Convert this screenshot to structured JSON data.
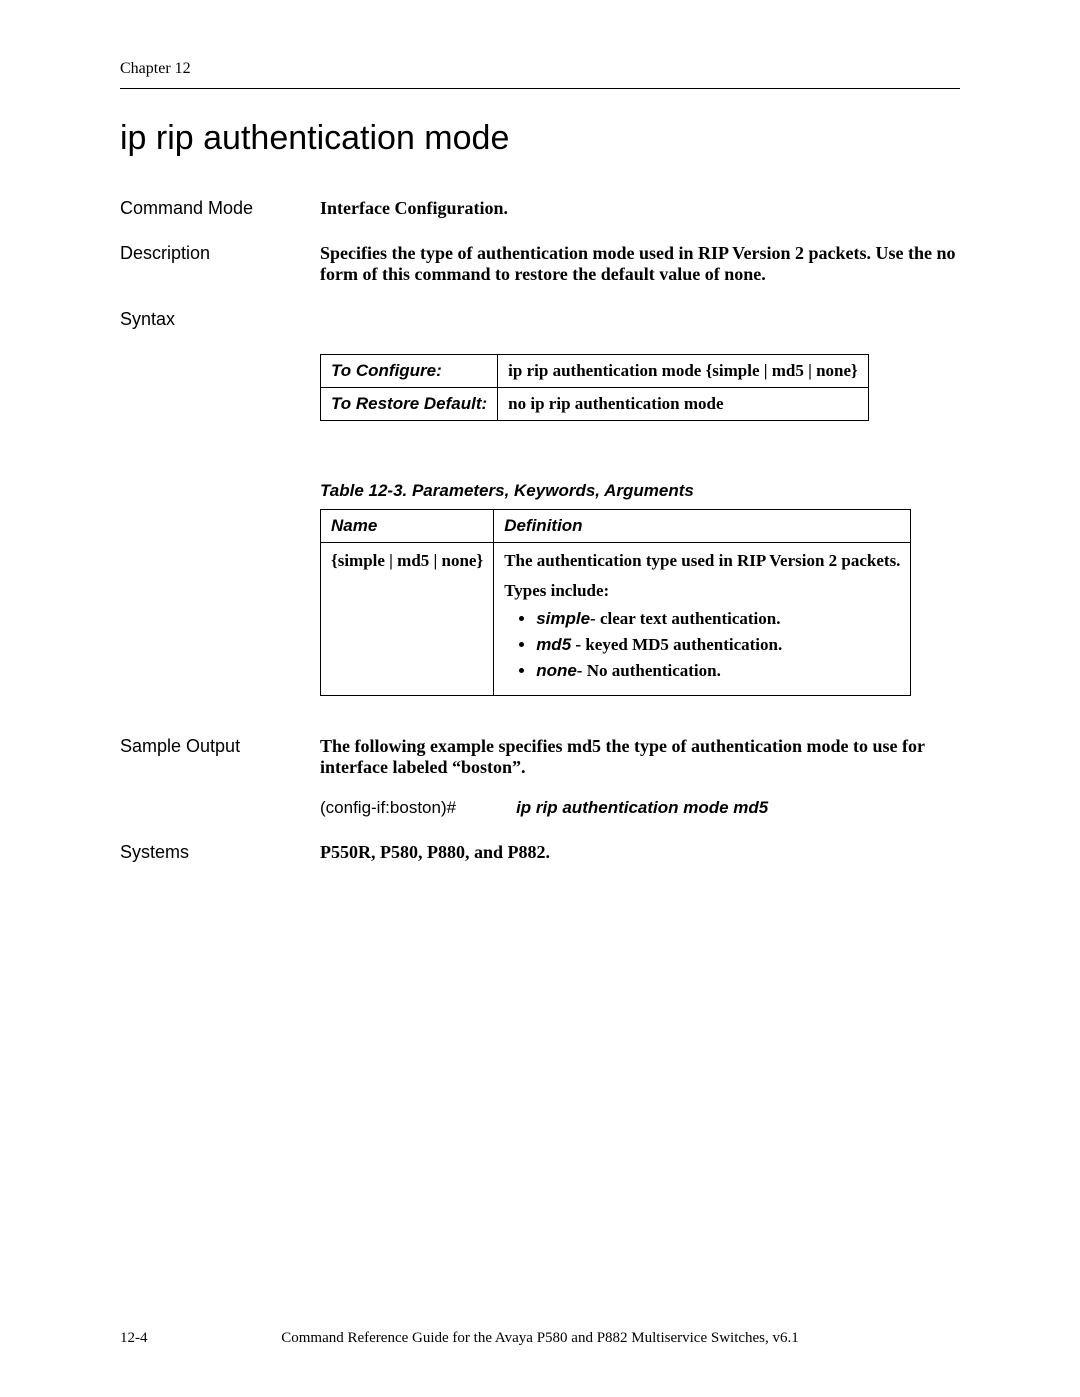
{
  "header": {
    "chapter": "Chapter 12"
  },
  "title": "ip rip authentication mode",
  "sections": {
    "commandMode": {
      "label": "Command Mode",
      "value": "Interface Configuration."
    },
    "description": {
      "label": "Description",
      "value": "Specifies the type of authentication mode used in RIP Version 2 packets. Use the no form of this command to restore the default value of none."
    },
    "syntax": {
      "label": "Syntax"
    },
    "sampleOutput": {
      "label": "Sample Output",
      "lead": "The following example specifies md5 the type of authentication mode to use for interface labeled “boston”.",
      "prompt": "(config-if:boston)#",
      "command": "ip rip authentication mode md5"
    },
    "systems": {
      "label": "Systems",
      "value": "P550R, P580, P880, and P882."
    }
  },
  "syntaxTable": {
    "rows": [
      {
        "label": "To Configure:",
        "value": "ip rip authentication mode {simple | md5 | none}"
      },
      {
        "label": "To Restore Default:",
        "value": "no ip rip authentication mode"
      }
    ]
  },
  "paramTable": {
    "caption": "Table 12-3.  Parameters, Keywords, Arguments",
    "headers": {
      "name": "Name",
      "definition": "Definition"
    },
    "row": {
      "name": "{simple | md5 | none}",
      "defLead": "The authentication type used in RIP Version 2 packets.",
      "defSub": "Types include:",
      "types": [
        {
          "kw": "simple",
          "sep": "- ",
          "text": "clear text authentication."
        },
        {
          "kw": "md5",
          "sep": " - ",
          "text": "keyed MD5 authentication."
        },
        {
          "kw": "none",
          "sep": "- ",
          "text": "No authentication."
        }
      ]
    }
  },
  "footer": {
    "pageNumber": "12-4",
    "bookTitle": "Command Reference Guide for the Avaya P580 and P882 Multiservice Switches, v6.1"
  }
}
